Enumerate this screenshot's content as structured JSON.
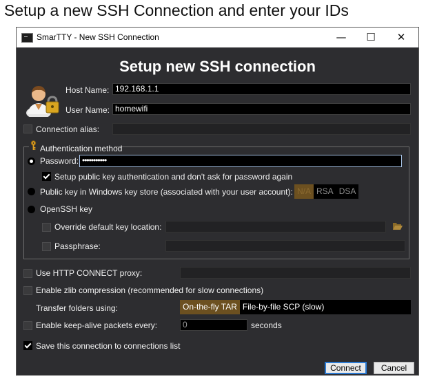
{
  "caption": "Setup a new SSH Connection and enter your IDs",
  "window": {
    "title": "SmarTTY - New SSH Connection",
    "minimize_glyph": "—",
    "maximize_glyph": "☐",
    "close_glyph": "✕"
  },
  "heading": "Setup new SSH connection",
  "host": {
    "label": "Host Name:",
    "value": "192.168.1.1"
  },
  "user": {
    "label": "User Name:",
    "value": "homewifi"
  },
  "alias": {
    "label": "Connection alias:",
    "value": "",
    "checked": false
  },
  "auth": {
    "legend": "Authentication method",
    "password_label": "Password:",
    "password_value": "•••••••••••",
    "setup_pubkey_label": "Setup public key authentication and don't ask for password again",
    "setup_pubkey_checked": true,
    "pubkey_store_label": "Public key in Windows key store (associated with your user account):",
    "key_types": [
      "N/A",
      "RSA",
      "DSA"
    ],
    "key_type_selected": "N/A",
    "openssh_label": "OpenSSH key",
    "override_label": "Override default key location:",
    "passphrase_label": "Passphrase:",
    "selected_method": "Password"
  },
  "proxy": {
    "label": "Use HTTP CONNECT proxy:",
    "checked": false
  },
  "zlib": {
    "label": "Enable zlib compression (recommended for slow connections)",
    "checked": false
  },
  "transfer": {
    "label": "Transfer folders using:",
    "options": [
      "On-the-fly TAR",
      "File-by-file SCP (slow)"
    ],
    "selected": "On-the-fly TAR"
  },
  "keepalive": {
    "label": "Enable keep-alive packets every:",
    "value": "0",
    "unit": "seconds",
    "checked": false
  },
  "save": {
    "label": "Save this connection to connections list",
    "checked": true
  },
  "buttons": {
    "connect": "Connect",
    "cancel": "Cancel"
  },
  "colors": {
    "window_bg": "#2d2d30",
    "accent_selected": "#6c5020",
    "focus_border": "#a8c4e8"
  },
  "icons": {
    "user": "user-lock-icon",
    "key": "key-icon",
    "folder": "folder-open-icon"
  }
}
